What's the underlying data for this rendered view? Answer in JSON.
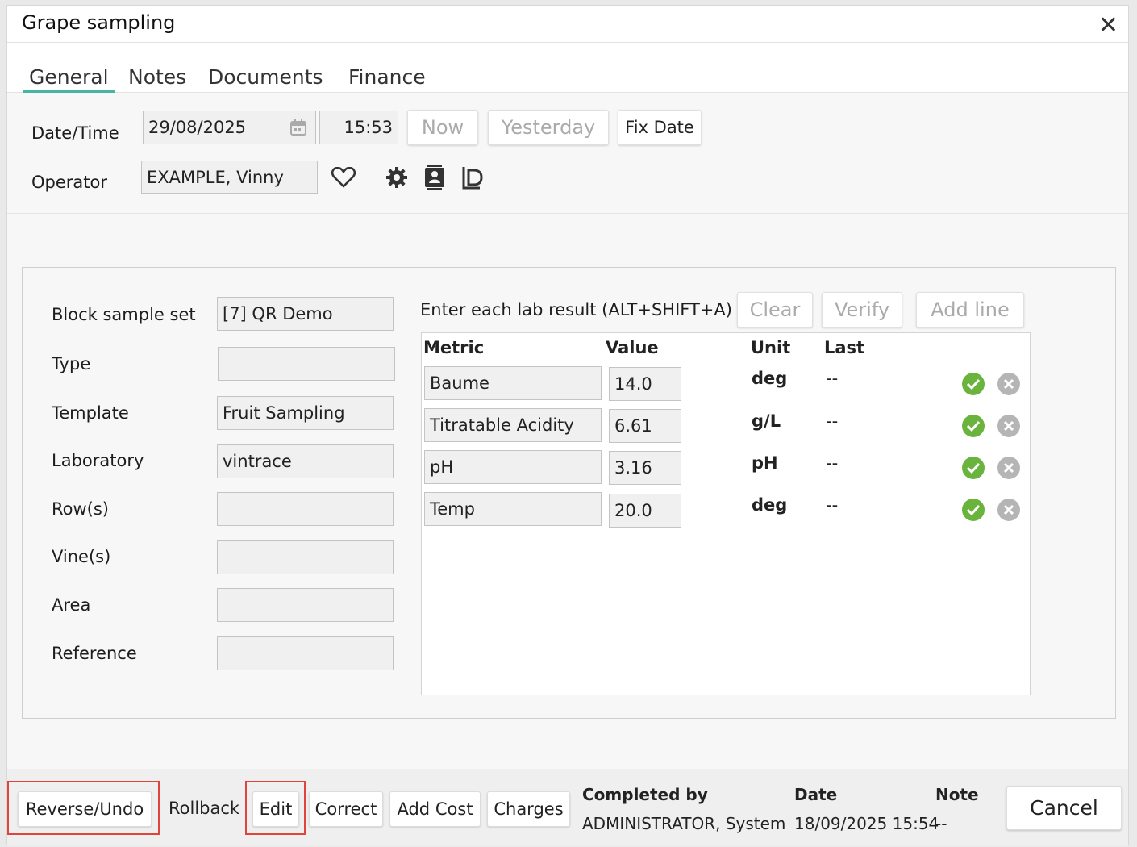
{
  "dialog": {
    "title": "Grape sampling"
  },
  "tabs": [
    {
      "label": "General"
    },
    {
      "label": "Notes"
    },
    {
      "label": "Documents"
    },
    {
      "label": "Finance"
    }
  ],
  "header": {
    "datetime_label": "Date/Time",
    "date_value": "29/08/2025",
    "time_value": "15:53",
    "now_label": "Now",
    "yesterday_label": "Yesterday",
    "fix_date_label": "Fix Date",
    "operator_label": "Operator",
    "operator_value": "EXAMPLE, Vinny"
  },
  "form": {
    "block_sample_set_label": "Block sample set",
    "block_sample_set_value": "[7] QR Demo",
    "type_label": "Type",
    "type_value": "",
    "template_label": "Template",
    "template_value": "Fruit Sampling",
    "laboratory_label": "Laboratory",
    "laboratory_value": "vintrace",
    "rows_label": "Row(s)",
    "rows_value": "",
    "vines_label": "Vine(s)",
    "vines_value": "",
    "area_label": "Area",
    "area_value": "",
    "reference_label": "Reference",
    "reference_value": ""
  },
  "lab": {
    "prompt": "Enter each lab result (ALT+SHIFT+A)",
    "clear_label": "Clear",
    "verify_label": "Verify",
    "add_line_label": "Add line",
    "columns": {
      "metric": "Metric",
      "value": "Value",
      "unit": "Unit",
      "last": "Last"
    },
    "rows": [
      {
        "metric": "Baume",
        "value": "14.0",
        "unit": "deg",
        "last": "--"
      },
      {
        "metric": "Titratable Acidity",
        "value": "6.61",
        "unit": "g/L",
        "last": "--"
      },
      {
        "metric": "pH",
        "value": "3.16",
        "unit": "pH",
        "last": "--"
      },
      {
        "metric": "Temp",
        "value": "20.0",
        "unit": "deg",
        "last": "--"
      }
    ]
  },
  "footer": {
    "reverse_undo_label": "Reverse/Undo",
    "rollback_label": "Rollback",
    "edit_label": "Edit",
    "correct_label": "Correct",
    "add_cost_label": "Add Cost",
    "charges_label": "Charges",
    "completed_by_label": "Completed by",
    "completed_by_value": "ADMINISTRATOR, System",
    "date_label": "Date",
    "date_value": "18/09/2025 15:54",
    "note_label": "Note",
    "note_value": "--",
    "cancel_label": "Cancel"
  },
  "colors": {
    "accent": "#46b5a3",
    "highlight": "#e0443a",
    "verify_green": "#6ab43e",
    "remove_grey": "#b5b5b5"
  },
  "icons": [
    "calendar-icon",
    "heart-icon",
    "gear-icon",
    "contact-card-icon",
    "document-d-icon",
    "check-circle-icon",
    "remove-circle-icon",
    "close-icon"
  ]
}
